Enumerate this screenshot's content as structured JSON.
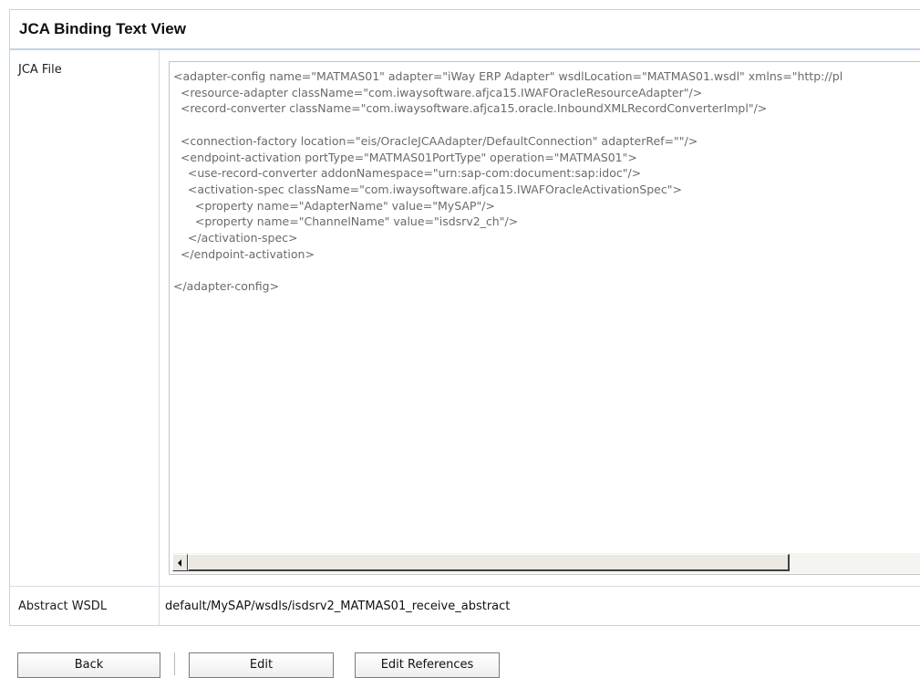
{
  "panel": {
    "title": "JCA Binding Text View"
  },
  "rows": {
    "jca_file_label": "JCA File",
    "abstract_wsdl_label": "Abstract WSDL",
    "abstract_wsdl_value": "default/MySAP/wsdls/isdsrv2_MATMAS01_receive_abstract"
  },
  "jca_file_content": "<adapter-config name=\"MATMAS01\" adapter=\"iWay ERP Adapter\" wsdlLocation=\"MATMAS01.wsdl\" xmlns=\"http://pl\n  <resource-adapter className=\"com.iwaysoftware.afjca15.IWAFOracleResourceAdapter\"/>\n  <record-converter className=\"com.iwaysoftware.afjca15.oracle.InboundXMLRecordConverterImpl\"/>\n\n  <connection-factory location=\"eis/OracleJCAAdapter/DefaultConnection\" adapterRef=\"\"/>\n  <endpoint-activation portType=\"MATMAS01PortType\" operation=\"MATMAS01\">\n    <use-record-converter addonNamespace=\"urn:sap-com:document:sap:idoc\"/>\n    <activation-spec className=\"com.iwaysoftware.afjca15.IWAFOracleActivationSpec\">\n      <property name=\"AdapterName\" value=\"MySAP\"/>\n      <property name=\"ChannelName\" value=\"isdsrv2_ch\"/>\n    </activation-spec>\n  </endpoint-activation>\n\n</adapter-config>",
  "buttons": {
    "back": "Back",
    "edit": "Edit",
    "edit_references": "Edit References"
  },
  "icons": {
    "scroll_left": "scroll-left-arrow-icon"
  }
}
